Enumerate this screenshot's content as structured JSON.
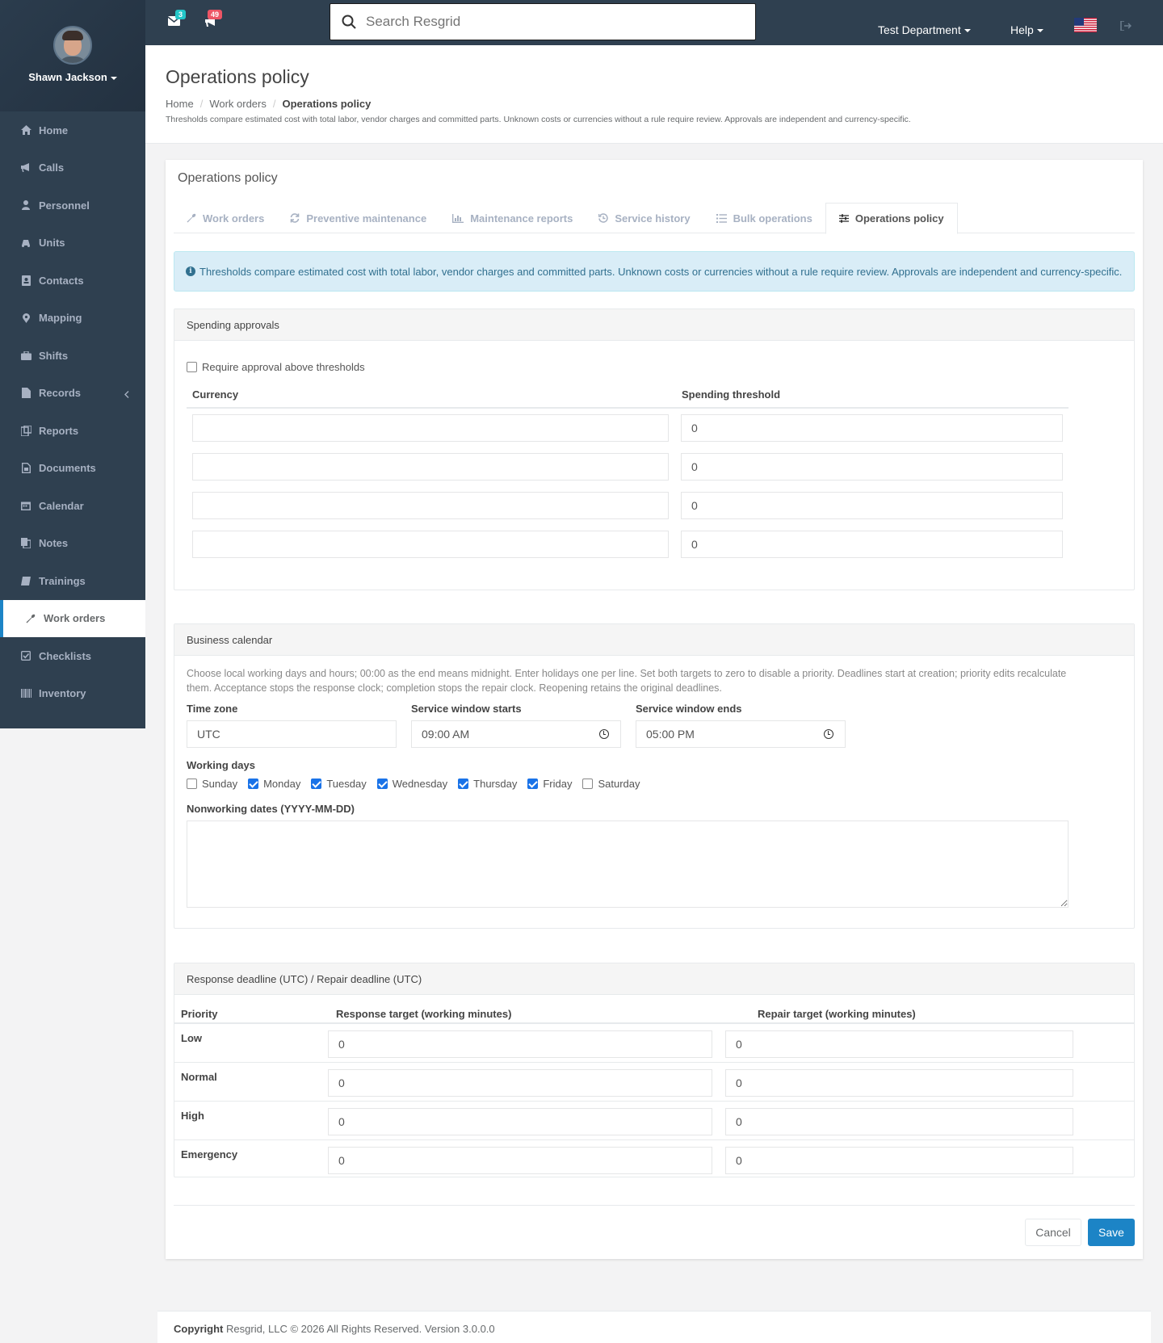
{
  "user": {
    "name": "Shawn Jackson"
  },
  "sidebar": {
    "items": [
      {
        "label": "Home",
        "icon": "home-icon"
      },
      {
        "label": "Calls",
        "icon": "bullhorn-icon"
      },
      {
        "label": "Personnel",
        "icon": "user-icon"
      },
      {
        "label": "Units",
        "icon": "truck-icon"
      },
      {
        "label": "Contacts",
        "icon": "address-book-icon"
      },
      {
        "label": "Mapping",
        "icon": "map-marker-icon"
      },
      {
        "label": "Shifts",
        "icon": "briefcase-icon"
      },
      {
        "label": "Records",
        "icon": "file-icon"
      },
      {
        "label": "Reports",
        "icon": "reports-icon"
      },
      {
        "label": "Documents",
        "icon": "document-icon"
      },
      {
        "label": "Calendar",
        "icon": "calendar-icon"
      },
      {
        "label": "Notes",
        "icon": "notes-icon"
      },
      {
        "label": "Trainings",
        "icon": "book-icon"
      },
      {
        "label": "Work orders",
        "icon": "wrench-icon"
      },
      {
        "label": "Checklists",
        "icon": "check-square-icon"
      },
      {
        "label": "Inventory",
        "icon": "barcode-icon"
      }
    ],
    "active": "Work orders"
  },
  "topbar": {
    "messages_count": "3",
    "calls_count": "49",
    "search_placeholder": "Search Resgrid",
    "department": "Test Department",
    "help": "Help",
    "colors": {
      "messages_badge": "#23c6c8",
      "calls_badge": "#ed5565"
    }
  },
  "heading": {
    "title": "Operations policy",
    "crumbs": [
      "Home",
      "Work orders",
      "Operations policy"
    ],
    "note": "Thresholds compare estimated cost with total labor, vendor charges and committed parts. Unknown costs or currencies without a rule require review. Approvals are independent and currency-specific."
  },
  "panel": {
    "title": "Operations policy",
    "tabs": [
      {
        "label": "Work orders",
        "icon": "wrench-icon"
      },
      {
        "label": "Preventive maintenance",
        "icon": "refresh-icon"
      },
      {
        "label": "Maintenance reports",
        "icon": "bar-chart-icon"
      },
      {
        "label": "Service history",
        "icon": "history-icon"
      },
      {
        "label": "Bulk operations",
        "icon": "list-icon"
      },
      {
        "label": "Operations policy",
        "icon": "sliders-icon"
      }
    ],
    "alert": "Thresholds compare estimated cost with total labor, vendor charges and committed parts. Unknown costs or currencies without a rule require review. Approvals are independent and currency-specific."
  },
  "spending": {
    "title": "Spending approvals",
    "require_label": "Require approval above thresholds",
    "require_checked": false,
    "col_currency": "Currency",
    "col_threshold": "Spending threshold",
    "rows": [
      {
        "currency": "",
        "threshold": "0"
      },
      {
        "currency": "",
        "threshold": "0"
      },
      {
        "currency": "",
        "threshold": "0"
      },
      {
        "currency": "",
        "threshold": "0"
      }
    ]
  },
  "calendar": {
    "title": "Business calendar",
    "help": "Choose local working days and hours; 00:00 as the end means midnight. Enter holidays one per line. Set both targets to zero to disable a priority. Deadlines start at creation; priority edits recalculate them. Acceptance stops the response clock; completion stops the repair clock. Reopening retains the original deadlines.",
    "timezone_label": "Time zone",
    "timezone_value": "UTC",
    "start_label": "Service window starts",
    "start_value": "09:00 AM",
    "end_label": "Service window ends",
    "end_value": "05:00 PM",
    "days_label": "Working days",
    "days": [
      {
        "label": "Sunday",
        "checked": false
      },
      {
        "label": "Monday",
        "checked": true
      },
      {
        "label": "Tuesday",
        "checked": true
      },
      {
        "label": "Wednesday",
        "checked": true
      },
      {
        "label": "Thursday",
        "checked": true
      },
      {
        "label": "Friday",
        "checked": true
      },
      {
        "label": "Saturday",
        "checked": false
      }
    ],
    "nonworking_label": "Nonworking dates (YYYY-MM-DD)",
    "nonworking_value": ""
  },
  "deadlines": {
    "title": "Response deadline (UTC) / Repair deadline (UTC)",
    "col_priority": "Priority",
    "col_response": "Response target (working minutes)",
    "col_repair": "Repair target (working minutes)",
    "rows": [
      {
        "priority": "Low",
        "response": "0",
        "repair": "0"
      },
      {
        "priority": "Normal",
        "response": "0",
        "repair": "0"
      },
      {
        "priority": "High",
        "response": "0",
        "repair": "0"
      },
      {
        "priority": "Emergency",
        "response": "0",
        "repair": "0"
      }
    ]
  },
  "actions": {
    "cancel": "Cancel",
    "save": "Save",
    "save_color": "#1c84c6"
  },
  "footer": {
    "copyright": "Copyright",
    "company": "Resgrid, LLC © 2026 All Rights Reserved.",
    "version": "Version 3.0.0.0"
  }
}
